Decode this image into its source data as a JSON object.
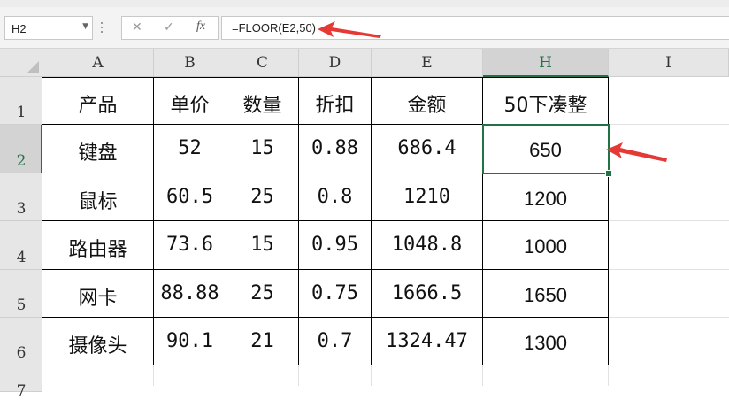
{
  "name_box": {
    "value": "H2"
  },
  "formula_bar": {
    "cancel_icon": "✕",
    "enter_icon": "✓",
    "fx_label": "fx",
    "formula": "=FLOOR(E2,50)"
  },
  "columns": [
    "A",
    "B",
    "C",
    "D",
    "E",
    "H",
    "I"
  ],
  "rows": [
    "1",
    "2",
    "3",
    "4",
    "5",
    "6",
    "7"
  ],
  "selected_cell": {
    "column": "H",
    "row": "2"
  },
  "table": {
    "header": [
      "产品",
      "单价",
      "数量",
      "折扣",
      "金额",
      "50下凑整"
    ],
    "rows": [
      [
        "键盘",
        "52",
        "15",
        "0.88",
        "686.4",
        "650"
      ],
      [
        "鼠标",
        "60.5",
        "25",
        "0.8",
        "1210",
        "1200"
      ],
      [
        "路由器",
        "73.6",
        "15",
        "0.95",
        "1048.8",
        "1000"
      ],
      [
        "网卡",
        "88.88",
        "25",
        "0.75",
        "1666.5",
        "1650"
      ],
      [
        "摄像头",
        "90.1",
        "21",
        "0.7",
        "1324.47",
        "1300"
      ]
    ]
  },
  "colors": {
    "selection": "#217346",
    "annotation_arrow": "#e53935"
  }
}
